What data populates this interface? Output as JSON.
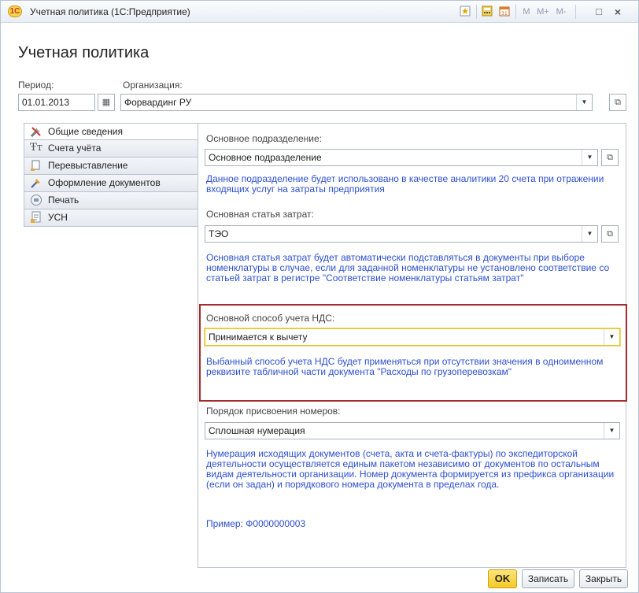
{
  "window": {
    "title": "Учетная политика  (1С:Предприятие)",
    "memory_buttons": [
      "M",
      "M+",
      "M-"
    ]
  },
  "page_title": "Учетная политика",
  "header": {
    "period_label": "Период:",
    "period_value": "01.01.2013",
    "org_label": "Организация:",
    "org_value": "Форвардинг РУ"
  },
  "tabs": [
    {
      "label": "Общие сведения",
      "icon": "tools-icon",
      "active": true
    },
    {
      "label": "Счета учёта",
      "icon": "accounts-icon",
      "active": false
    },
    {
      "label": "Перевыставление",
      "icon": "rebilling-icon",
      "active": false
    },
    {
      "label": "Оформление документов",
      "icon": "documents-icon",
      "active": false
    },
    {
      "label": "Печать",
      "icon": "print-icon",
      "active": false
    },
    {
      "label": "УСН",
      "icon": "usn-icon",
      "active": false
    }
  ],
  "general": {
    "division_label": "Основное подразделение:",
    "division_value": "Основное подразделение",
    "division_hint": "Данное подразделение будет использовано в качестве аналитики 20 счета при отражении входящих услуг на затраты предприятия",
    "cost_item_label": "Основная статья затрат:",
    "cost_item_value": "ТЭО",
    "cost_item_hint": "Основная статья затрат будет автоматически подставляться в документы при выборе номенклатуры в случае, если для заданной номенклатуры не установлено соответствие со статьей затрат в регистре \"Соответствие номенклатуры статьям затрат\"",
    "vat_label": "Основной способ учета НДС:",
    "vat_value": "Принимается к вычету",
    "vat_hint": "Выбанный способ учета НДС будет применяться при отсутствии значения в одноименном реквизите табличной части документа \"Расходы по грузоперевозкам\"",
    "numbering_label": "Порядок присвоения номеров:",
    "numbering_value": "Сплошная нумерация",
    "numbering_hint": "Нумерация исходящих документов (счета, акта и счета-фактуры) по экспедиторской деятельности осуществляется единым пакетом независимо от документов по остальным видам деятельности организации. Номер документа формируется из префикса организации (если он задан) и порядкового номера документа в пределах года.",
    "example": "Пример: Ф0000000003"
  },
  "footer": {
    "ok": "OK",
    "save": "Записать",
    "close": "Закрыть"
  },
  "colors": {
    "hint_text": "#2c4fd0",
    "highlight_border": "#a42c2c",
    "focus_border": "#e5c12d",
    "ok_button": "#f6c928"
  }
}
